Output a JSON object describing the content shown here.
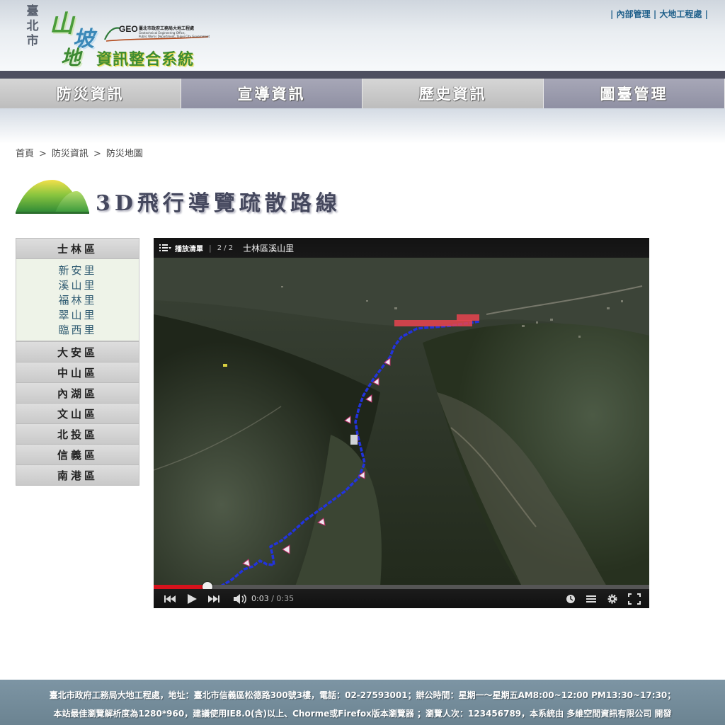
{
  "header": {
    "city": [
      "臺",
      "北",
      "市"
    ],
    "logo_chars": [
      "山",
      "坡",
      "地"
    ],
    "system_name": "資訊整合系統",
    "org_logo_text": "GEO",
    "org_name": "臺北市政府工務局大地工程處",
    "org_name_en_1": "Geotechnical Engineering Office,",
    "org_name_en_2": "Public Works Department, Taipei City Government",
    "top_links": [
      "內部管理",
      "大地工程處"
    ],
    "link_separator": "|"
  },
  "nav": {
    "tabs": [
      {
        "label": "防災資訊"
      },
      {
        "label": "宣導資訊"
      },
      {
        "label": "歷史資訊"
      },
      {
        "label": "圖臺管理"
      }
    ]
  },
  "breadcrumb": {
    "items": [
      "首頁",
      "防災資訊",
      "防災地圖"
    ],
    "separator": ">"
  },
  "page_title": "3D飛行導覽疏散路線",
  "sidemenu": {
    "districts": [
      "士林區",
      "大安區",
      "中山區",
      "內湖區",
      "文山區",
      "北投區",
      "信義區",
      "南港區"
    ],
    "expanded_villages": [
      "新安里",
      "溪山里",
      "福林里",
      "翠山里",
      "臨西里"
    ]
  },
  "player": {
    "playlist_label": "播放清單",
    "playlist_position": "2 / 2",
    "video_title": "士林區溪山里",
    "current_time": "0:03",
    "total_time": "0:35",
    "time_separator": " / ",
    "progress_fraction": 0.109,
    "route_color": "#2233dd",
    "progress_color": "#d7121c"
  },
  "footer": {
    "line1": "臺北市政府工務局大地工程處，地址：臺北市信義區松德路300號3樓，電話：02-27593001；辦公時間：星期一～星期五AM8:00~12:00 PM13:30~17:30；",
    "line2": "本站最佳瀏覽解析度為1280*960，建議使用IE8.0(含)以上、Chorme或Firefox版本瀏覽器 ；瀏覽人次：123456789，本系統由 多維空間資訊有限公司 開發"
  }
}
